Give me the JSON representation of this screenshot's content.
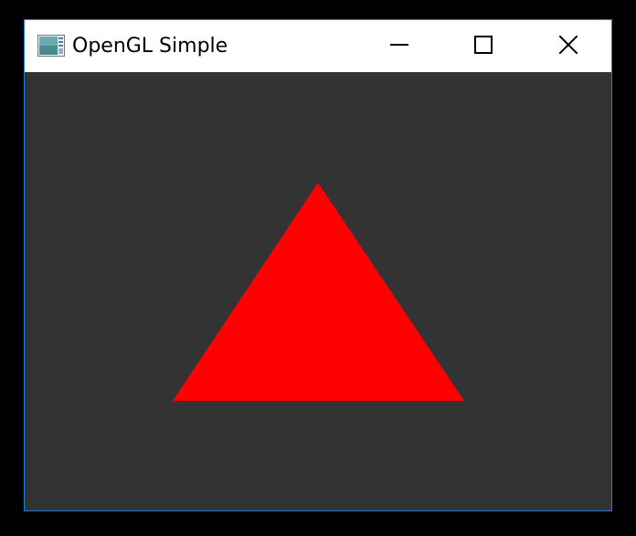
{
  "window": {
    "title": "OpenGL Simple",
    "border_color": "#2b7bd4",
    "titlebar_bg": "#ffffff",
    "client_bg": "#333333",
    "icons": {
      "app": "opengl-app-icon",
      "minimize": "minimize-icon",
      "maximize": "maximize-icon",
      "close": "close-icon"
    }
  },
  "scene": {
    "shape": "triangle",
    "fill_color": "#ff0000",
    "background_color": "#333333"
  }
}
